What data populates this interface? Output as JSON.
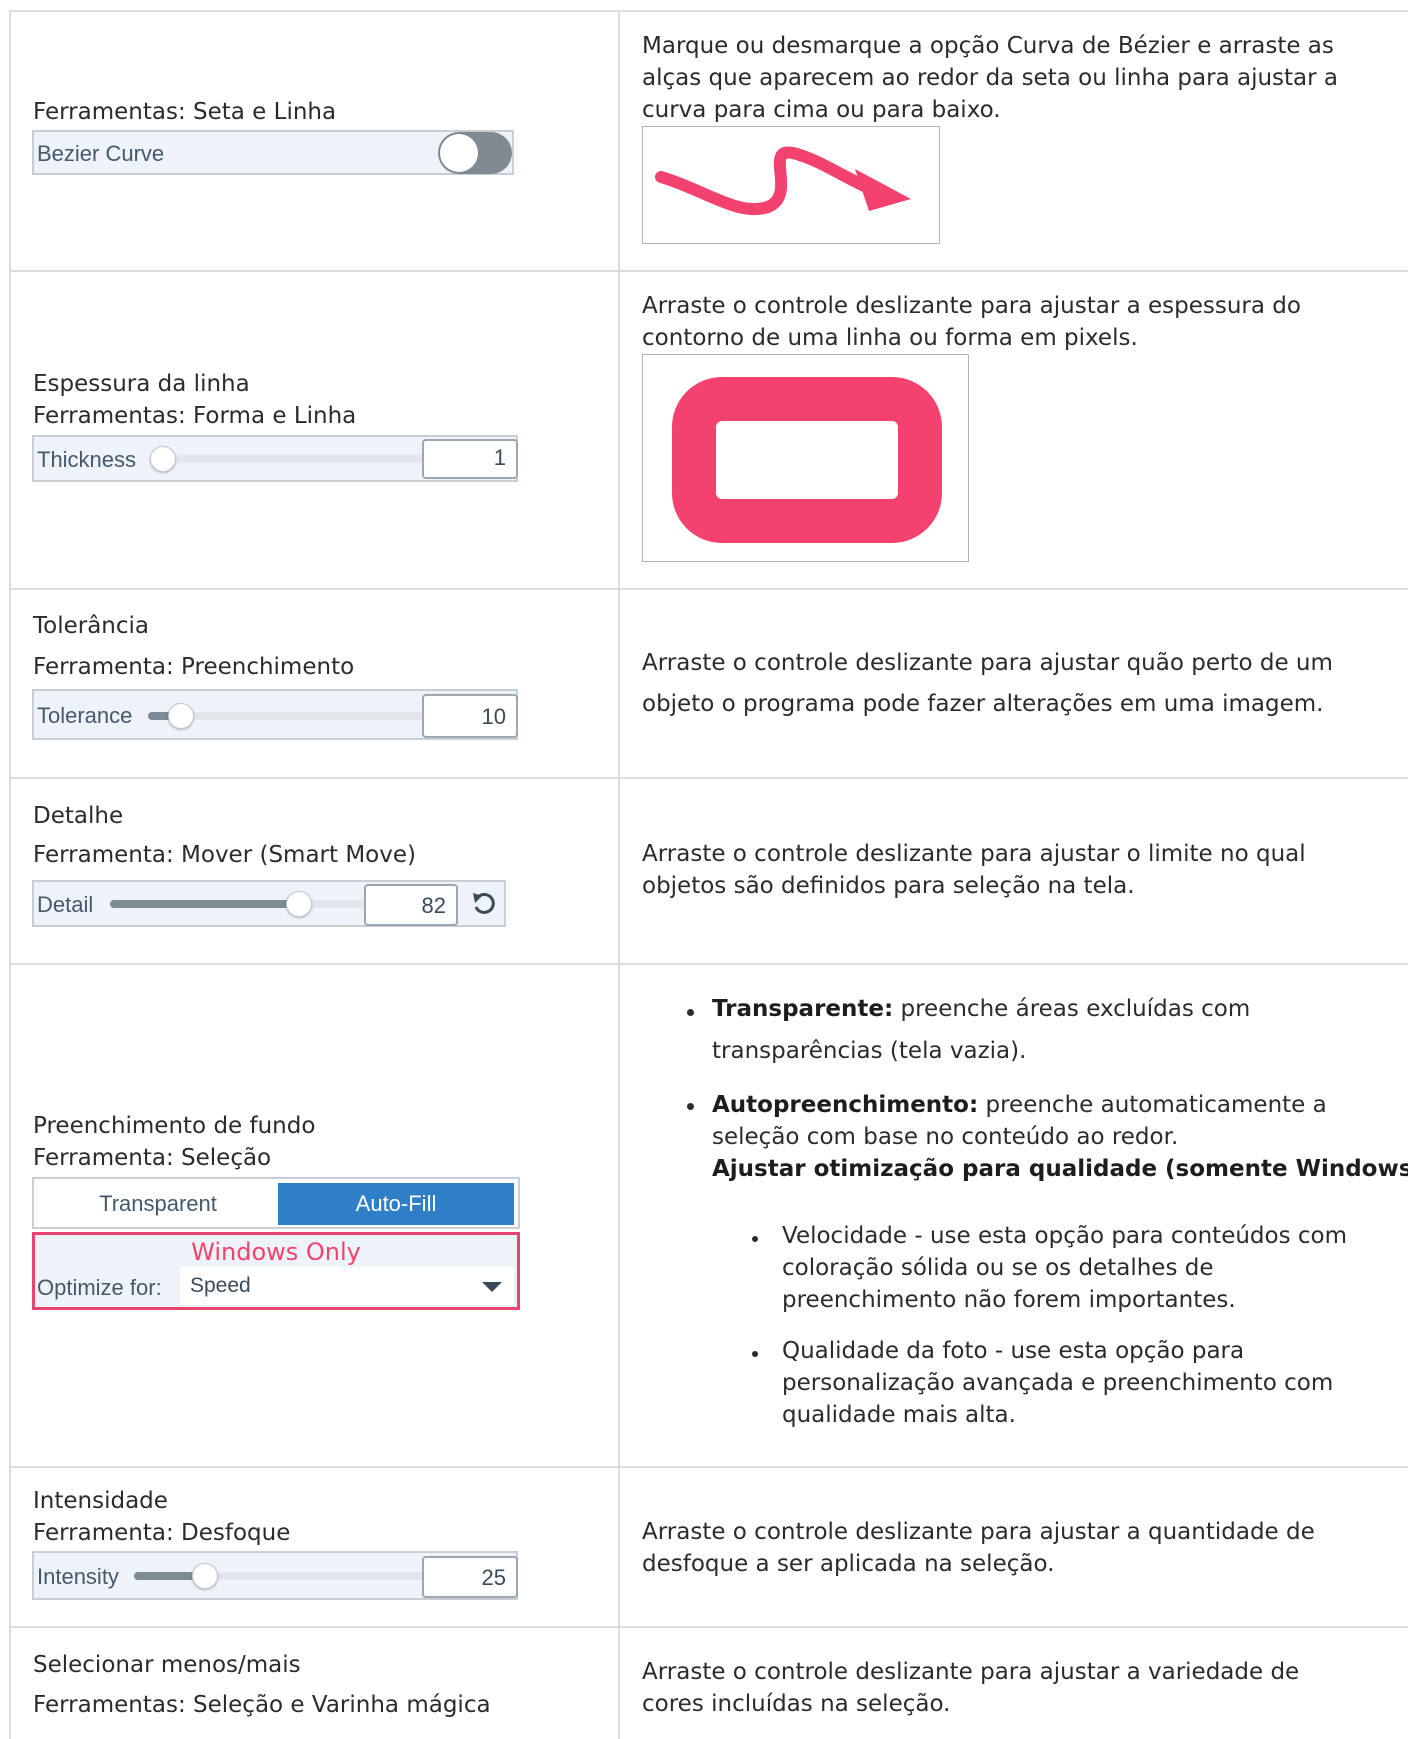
{
  "rows": {
    "bezier": {
      "left_line1": "Ferramentas: Seta e Linha",
      "widget_label": "Bezier Curve",
      "desc": "Marque ou desmarque a opção Curva de Bézier e arraste as alças que aparecem ao redor da seta ou linha para ajustar a curva para cima ou para baixo."
    },
    "thickness": {
      "left_line1": "Espessura da linha",
      "left_line2": "Ferramentas: Forma e Linha",
      "widget_label": "Thickness",
      "value": "1",
      "desc": "Arraste o controle deslizante para ajustar a espessura do contorno de uma linha ou forma em pixels."
    },
    "tolerance": {
      "left_line1": "Tolerância",
      "left_line2": "Ferramenta: Preenchimento",
      "widget_label": "Tolerance",
      "value": "10",
      "desc_line1": "Arraste o controle deslizante para ajustar quão perto de um",
      "desc_line2": "objeto o programa pode fazer alterações em uma imagem."
    },
    "detail": {
      "left_line1": "Detalhe",
      "left_line2": "Ferramenta: Mover (Smart Move)",
      "widget_label": "Detail",
      "value": "82",
      "desc": "Arraste o controle deslizante para ajustar o limite no qual objetos são definidos para seleção na tela."
    },
    "background_fill": {
      "left_line1": "Preenchimento de fundo",
      "left_line2": "Ferramenta: Seleção",
      "tab_transparent": "Transparent",
      "tab_autofill": "Auto-Fill",
      "windows_only": "Windows Only",
      "optimize_label": "Optimize for:",
      "optimize_value": "Speed",
      "b1_title": "Transparente:",
      "b1_text1": " preenche áreas excluídas com",
      "b1_text2": "transparências (tela vazia).",
      "b2_title": "Autopreenchimento:",
      "b2_text1": " preenche automaticamente a",
      "b2_text2": "seleção com base no conteúdo ao redor.",
      "b2_sub": "Ajustar otimização para qualidade (somente Windows):",
      "sub1": "Velocidade - use esta opção para conteúdos com coloração sólida ou se os detalhes de preenchimento não forem importantes.",
      "sub2": "Qualidade da foto - use esta opção para personalização avançada e preenchimento com qualidade mais alta."
    },
    "intensity": {
      "left_line1": "Intensidade",
      "left_line2": "Ferramenta: Desfoque",
      "widget_label": "Intensity",
      "value": "25",
      "desc": "Arraste o controle deslizante para ajustar a quantidade de desfoque a ser aplicada na seleção."
    },
    "select_more": {
      "left_line1": "Selecionar menos/mais",
      "left_line2": "Ferramentas: Seleção e Varinha mágica",
      "desc": "Arraste o controle deslizante para ajustar a variedade de cores incluídas na seleção."
    }
  },
  "colors": {
    "accent_pink": "#f4426e",
    "autofill_blue": "#2f7fc8",
    "border": "#dcdcdc"
  },
  "sliders": {
    "thickness_level": 0.0,
    "tolerance_level": 0.09,
    "detail_level": 0.82,
    "intensity_level": 0.25
  }
}
